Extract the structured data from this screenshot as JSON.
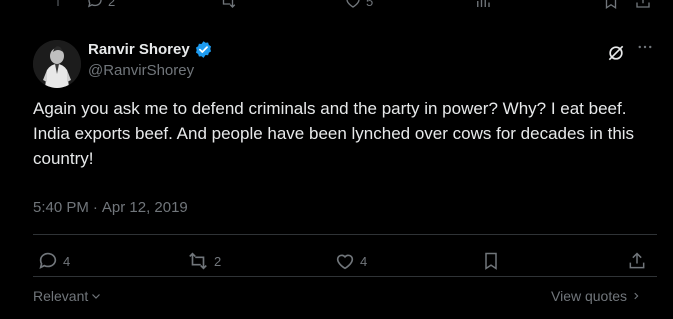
{
  "previous_tweet": {
    "replies": "2",
    "likes": "5"
  },
  "tweet": {
    "author_name": "Ranvir Shorey",
    "author_handle": "@RanvirShorey",
    "verified": true,
    "text": "Again you ask me to defend criminals and the party in power? Why? I eat beef. India exports beef. And people have been lynched over cows for decades in this country!",
    "time": "5:40 PM",
    "separator": "·",
    "date": "Apr 12, 2019",
    "stats": {
      "replies": "4",
      "reposts": "2",
      "likes": "4"
    }
  },
  "footer": {
    "sort_label": "Relevant",
    "view_quotes_label": "View quotes"
  },
  "colors": {
    "background": "#000000",
    "text_primary": "#e7e9ea",
    "text_secondary": "#71767b",
    "divider": "#2f3336",
    "verified_badge": "#1d9bf0"
  }
}
